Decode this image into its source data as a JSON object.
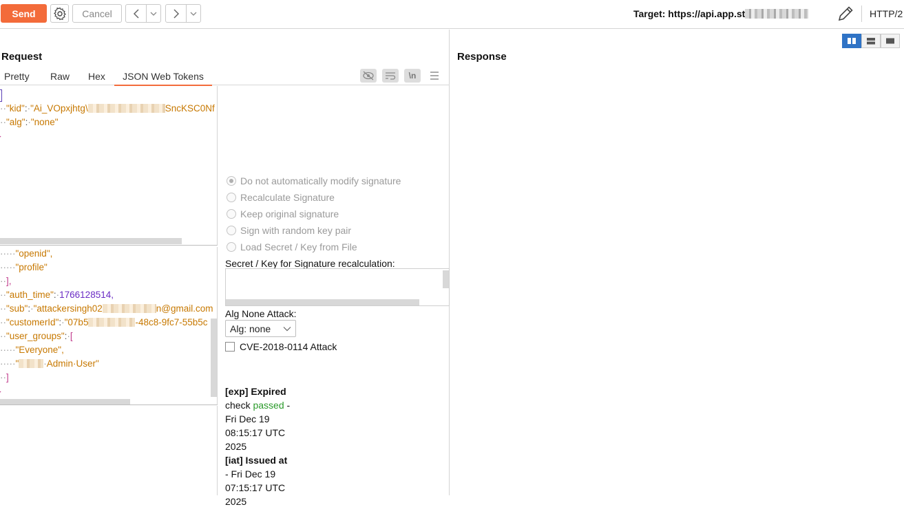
{
  "toolbar": {
    "send_label": "Send",
    "cancel_label": "Cancel",
    "target_label": "Target: https://api.app.st",
    "http_version": "HTTP/2"
  },
  "request": {
    "title": "Request",
    "tabs": [
      "Pretty",
      "Raw",
      "Hex",
      "JSON Web Tokens"
    ],
    "active_tab": "JSON Web Tokens",
    "tools": [
      "hide-icon",
      "wrap-icon",
      "newline-toggle",
      "menu-icon"
    ],
    "newline_label": "\\n"
  },
  "response": {
    "title": "Response"
  },
  "jwt_header": {
    "kid_key": "\"kid\"",
    "kid_value_start": "\"Ai_VOpxjhtg\\",
    "kid_value_end": "SncKSC0Nf",
    "alg_key": "\"alg\"",
    "alg_value": "\"none\""
  },
  "jwt_payload": {
    "openid": "\"openid\",",
    "profile": "\"profile\"",
    "array_close": "],",
    "auth_time_key": "\"auth_time\"",
    "auth_time_value": "1766128514,",
    "sub_key": "\"sub\"",
    "sub_value_start": "\"attackersingh02",
    "sub_value_end": "n@gmail.com",
    "customer_key": "\"customerId\"",
    "customer_value_start": "\"07b5",
    "customer_value_end": "-48c8-9fc7-55b5c",
    "groups_key": "\"user_groups\"",
    "groups_open": "[",
    "group_everyone": "\"Everyone\",",
    "group_admin_start": "\"",
    "group_admin_end": "Admin·User\"",
    "groups_close": "]"
  },
  "signature": {
    "options": [
      "Do not automatically modify signature",
      "Recalculate Signature",
      "Keep original signature",
      "Sign with random key pair",
      "Load Secret / Key from File"
    ],
    "selected_index": 0,
    "secret_label": "Secret / Key for Signature recalculation:",
    "alg_none_label": "Alg None Attack:",
    "alg_select_value": "Alg: none",
    "cve_label": "CVE-2018-0114 Attack",
    "exp_title": "[exp] Expired",
    "exp_check": "check",
    "exp_passed": "passed",
    "exp_dash": "-",
    "exp_line1": "Fri Dec 19",
    "exp_line2": "08:15:17 UTC",
    "exp_line3": "2025",
    "iat_title": "[iat] Issued at",
    "iat_line1": "- Fri Dec 19",
    "iat_line2": "07:15:17 UTC",
    "iat_line3": "2025"
  }
}
